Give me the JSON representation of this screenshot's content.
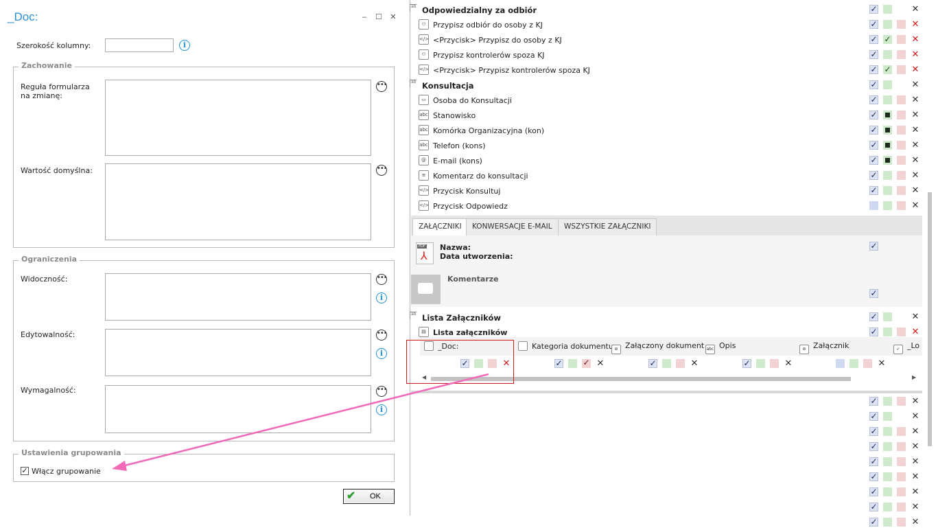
{
  "dialog": {
    "title": "_Doc:",
    "window_buttons": [
      "‒",
      "☐",
      "✕"
    ],
    "column_width_label": "Szerokość kolumny:",
    "column_width_value": "",
    "behavior": {
      "legend": "Zachowanie",
      "form_rule_label": "Reguła formularza na zmianę:",
      "default_value_label": "Wartość domyślna:"
    },
    "restrictions": {
      "legend": "Ograniczenia",
      "visibility_label": "Widoczność:",
      "editability_label": "Edytowalność:",
      "required_label": "Wymagalność:"
    },
    "grouping": {
      "legend": "Ustawienia grupowania",
      "enable_label": "Włącz grupowanie",
      "enabled": true
    },
    "ok_label": "OK"
  },
  "panel": {
    "rows": [
      {
        "type": "header",
        "text": "Odpowiedzialny za odbiór",
        "icon": "",
        "c1": "ck",
        "c2": "gr",
        "c3": "",
        "tool": "tool"
      },
      {
        "type": "item",
        "text": "Przypisz odbiór do osoby z KJ",
        "icon": "user-icon",
        "c1": "ck",
        "c2": "gr",
        "c3": "rd",
        "tool": "red"
      },
      {
        "type": "item",
        "text": "<Przycisk> Przypisz do osoby z KJ",
        "icon": "code-icon",
        "c1": "ck",
        "c2": "gck",
        "c3": "rd",
        "tool": "red"
      },
      {
        "type": "item",
        "text": "Przypisz kontrolerów spoza KJ",
        "icon": "user-icon",
        "c1": "ck",
        "c2": "gr",
        "c3": "rd",
        "tool": "red"
      },
      {
        "type": "item",
        "text": "<Przycisk> Przypisz kontrolerów spoza KJ",
        "icon": "code-icon",
        "c1": "ck",
        "c2": "gck",
        "c3": "rd",
        "tool": "red"
      },
      {
        "type": "header",
        "text": "Konsultacja",
        "icon": "",
        "c1": "ck",
        "c2": "gr",
        "c3": "",
        "tool": "tool"
      },
      {
        "type": "item",
        "text": "Osoba do Konsultacji",
        "icon": "window-icon",
        "c1": "ck",
        "c2": "gr",
        "c3": "rd",
        "tool": "tool"
      },
      {
        "type": "item",
        "text": "Stanowisko",
        "icon": "text-field-icon",
        "c1": "ck",
        "c2": "blk",
        "c3": "rd",
        "tool": "tool"
      },
      {
        "type": "item",
        "text": "Komórka Organizacyjna (kon)",
        "icon": "text-field-icon",
        "c1": "ck",
        "c2": "blk",
        "c3": "rd",
        "tool": "tool"
      },
      {
        "type": "item",
        "text": "Telefon (kons)",
        "icon": "text-field-icon",
        "c1": "ck",
        "c2": "blk",
        "c3": "rd",
        "tool": "tool"
      },
      {
        "type": "item",
        "text": "E-mail (kons)",
        "icon": "at-icon",
        "c1": "ck",
        "c2": "blk",
        "c3": "rd",
        "tool": "tool"
      },
      {
        "type": "item",
        "text": "Komentarz do konsultacji",
        "icon": "list-icon",
        "c1": "ck",
        "c2": "gr",
        "c3": "rd",
        "tool": "tool"
      },
      {
        "type": "item",
        "text": "Przycisk Konsultuj",
        "icon": "code-icon",
        "c1": "ck",
        "c2": "gr",
        "c3": "rd",
        "tool": "tool"
      },
      {
        "type": "item",
        "text": "Przycisk Odpowiedz",
        "icon": "code-icon",
        "c1": "bl",
        "c2": "gr",
        "c3": "rd",
        "tool": "tool"
      }
    ],
    "tabs": [
      "ZAŁĄCZNIKI",
      "KONWERSACJE E-MAIL",
      "WSZYSTKIE ZAŁĄCZNIKI"
    ],
    "attachment": {
      "name_label": "Nazwa:",
      "date_label": "Data utworzenia:"
    },
    "comments_label": "Komentarze",
    "attachments_header": "Lista Załączników",
    "attachments_list": "Lista załączników",
    "subgrid_columns": [
      "_Doc:",
      "Kategoria dokumentu",
      "Załączony dokument",
      "Opis",
      "Załącznik",
      "_Lo"
    ],
    "lower_rows": [
      {
        "c1": "ck",
        "c2": "gr",
        "c3": "rd",
        "tool": "tool"
      },
      {
        "c1": "ck",
        "c2": "gr",
        "c3": "",
        "tool": "tool"
      },
      {
        "c1": "ck",
        "c2": "gr",
        "c3": "rd",
        "tool": "tool"
      },
      {
        "c1": "ck",
        "c2": "gr",
        "c3": "rd",
        "tool": "tool"
      },
      {
        "c1": "ck",
        "c2": "gr",
        "c3": "rd",
        "tool": "tool"
      },
      {
        "c1": "ck",
        "c2": "gr",
        "c3": "rd",
        "tool": "tool"
      },
      {
        "c1": "ck",
        "c2": "gr",
        "c3": "rd",
        "tool": "tool"
      },
      {
        "c1": "ck",
        "c2": "gr",
        "c3": "rd",
        "tool": "tool"
      },
      {
        "c1": "ck",
        "c2": "gr",
        "c3": "rd",
        "tool": "tool"
      }
    ]
  },
  "colors": {
    "accent": "#2a8fd0",
    "highlight": "#d11a1a",
    "arrow": "#f06ab8"
  }
}
